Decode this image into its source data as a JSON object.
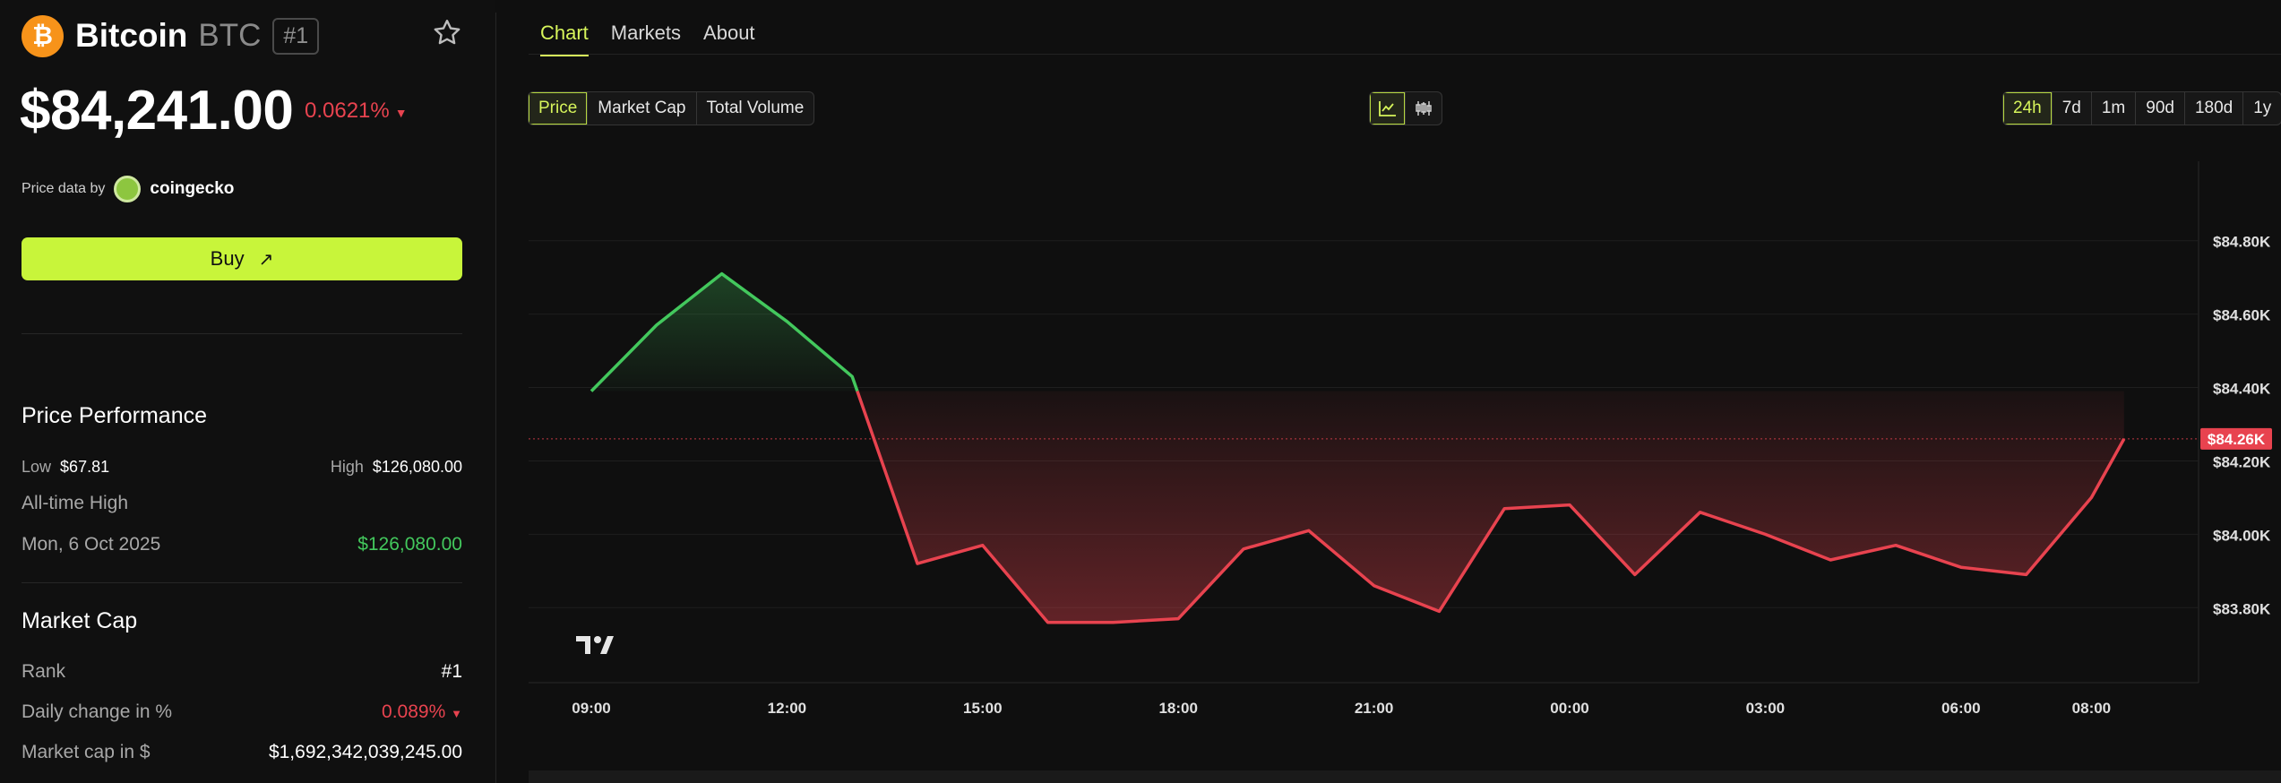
{
  "coin": {
    "logo_glyph": "₿",
    "name": "Bitcoin",
    "symbol": "BTC",
    "rank_badge": "#1",
    "price": "$84,241.00",
    "change": "0.0621%",
    "change_arrow": "▼",
    "price_source_label": "Price data by",
    "price_source_name": "coingecko"
  },
  "buy_button": {
    "label": "Buy",
    "arrow": "↗"
  },
  "performance": {
    "title": "Price Performance",
    "low_label": "Low",
    "low_value": "$67.81",
    "high_label": "High",
    "high_value": "$126,080.00",
    "ath_label": "All-time High",
    "ath_date": "Mon, 6 Oct 2025",
    "ath_value": "$126,080.00"
  },
  "market_cap": {
    "title": "Market Cap",
    "rank_label": "Rank",
    "rank_value": "#1",
    "daily_label": "Daily change in %",
    "daily_value": "0.089%",
    "daily_arrow": "▼",
    "cap_label": "Market cap in $",
    "cap_value": "$1,692,342,039,245.00"
  },
  "tabs": [
    "Chart",
    "Markets",
    "About"
  ],
  "metric_toggle": [
    "Price",
    "Market Cap",
    "Total Volume"
  ],
  "range_toggle": [
    "24h",
    "7d",
    "1m",
    "90d",
    "180d",
    "1y"
  ],
  "chart_view_icons": [
    "line-chart-icon",
    "candlestick-icon"
  ],
  "colors": {
    "accent": "#c8f53a",
    "up": "#43c85d",
    "down": "#e8434f"
  },
  "chart_data": {
    "type": "line",
    "x_ticks": [
      "09:00",
      "12:00",
      "15:00",
      "18:00",
      "21:00",
      "00:00",
      "03:00",
      "06:00",
      "08:00"
    ],
    "y_ticks": [
      "$84.80K",
      "$84.60K",
      "$84.40K",
      "$84.20K",
      "$84.00K",
      "$83.80K"
    ],
    "current_price_label": "$84.26K",
    "baseline": 84390,
    "ylim": [
      83620,
      84980
    ],
    "series": [
      {
        "x": [
          "09:00",
          "10:00",
          "11:00",
          "12:00",
          "13:00",
          "14:00",
          "15:00",
          "16:00",
          "17:00",
          "18:00",
          "19:00",
          "20:00",
          "21:00",
          "22:00",
          "23:00",
          "00:00",
          "01:00",
          "02:00",
          "03:00",
          "04:00",
          "05:00",
          "06:00",
          "07:00",
          "08:00",
          "08:30"
        ],
        "values": [
          84390,
          84570,
          84710,
          84580,
          84430,
          83920,
          83970,
          83760,
          83760,
          83770,
          83960,
          84010,
          83860,
          83790,
          84070,
          84080,
          83890,
          84060,
          84000,
          83930,
          83970,
          83910,
          83890,
          84100,
          84260
        ]
      }
    ]
  }
}
